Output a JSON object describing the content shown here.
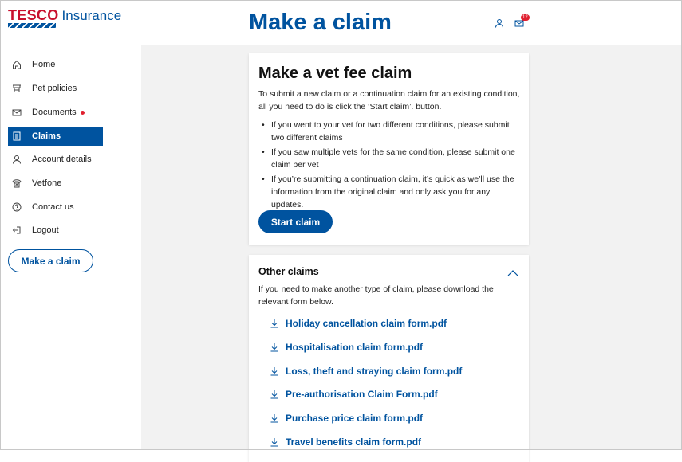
{
  "brand": {
    "name": "TESCO",
    "product": "Insurance",
    "color": "#00539f",
    "accent": "#c8102e"
  },
  "header": {
    "title": "Make a claim",
    "notification_count": "12"
  },
  "sidebar": {
    "items": [
      {
        "label": "Home",
        "icon": "home-icon"
      },
      {
        "label": "Pet policies",
        "icon": "pet-icon"
      },
      {
        "label": "Documents",
        "icon": "mail-icon",
        "has_dot": true
      },
      {
        "label": "Claims",
        "icon": "claims-icon",
        "active": true
      },
      {
        "label": "Account details",
        "icon": "user-icon"
      },
      {
        "label": "Vetfone",
        "icon": "phone-icon"
      },
      {
        "label": "Contact us",
        "icon": "help-icon"
      },
      {
        "label": "Logout",
        "icon": "logout-icon"
      }
    ],
    "button_label": "Make a claim"
  },
  "vet_claim": {
    "title": "Make a vet fee claim",
    "intro": "To submit a new claim or a continuation claim for an existing condition, all you need to do is click the ‘Start claim’. button.",
    "bullets": [
      "If you went to your vet for two different conditions, please submit two different claims",
      "If you saw multiple vets for the same condition, please submit one claim per vet",
      "If you’re submitting a continuation claim, it’s quick as we’ll use the information from the original claim and only ask you for any updates."
    ],
    "button_label": "Start claim"
  },
  "other_claims": {
    "title": "Other claims",
    "description": "If you need to make another type of claim, please download the relevant form below.",
    "forms": [
      "Holiday cancellation claim form.pdf",
      "Hospitalisation claim form.pdf",
      "Loss, theft and straying claim form.pdf",
      "Pre-authorisation Claim Form.pdf",
      "Purchase price claim form.pdf",
      "Travel benefits claim form.pdf"
    ]
  }
}
